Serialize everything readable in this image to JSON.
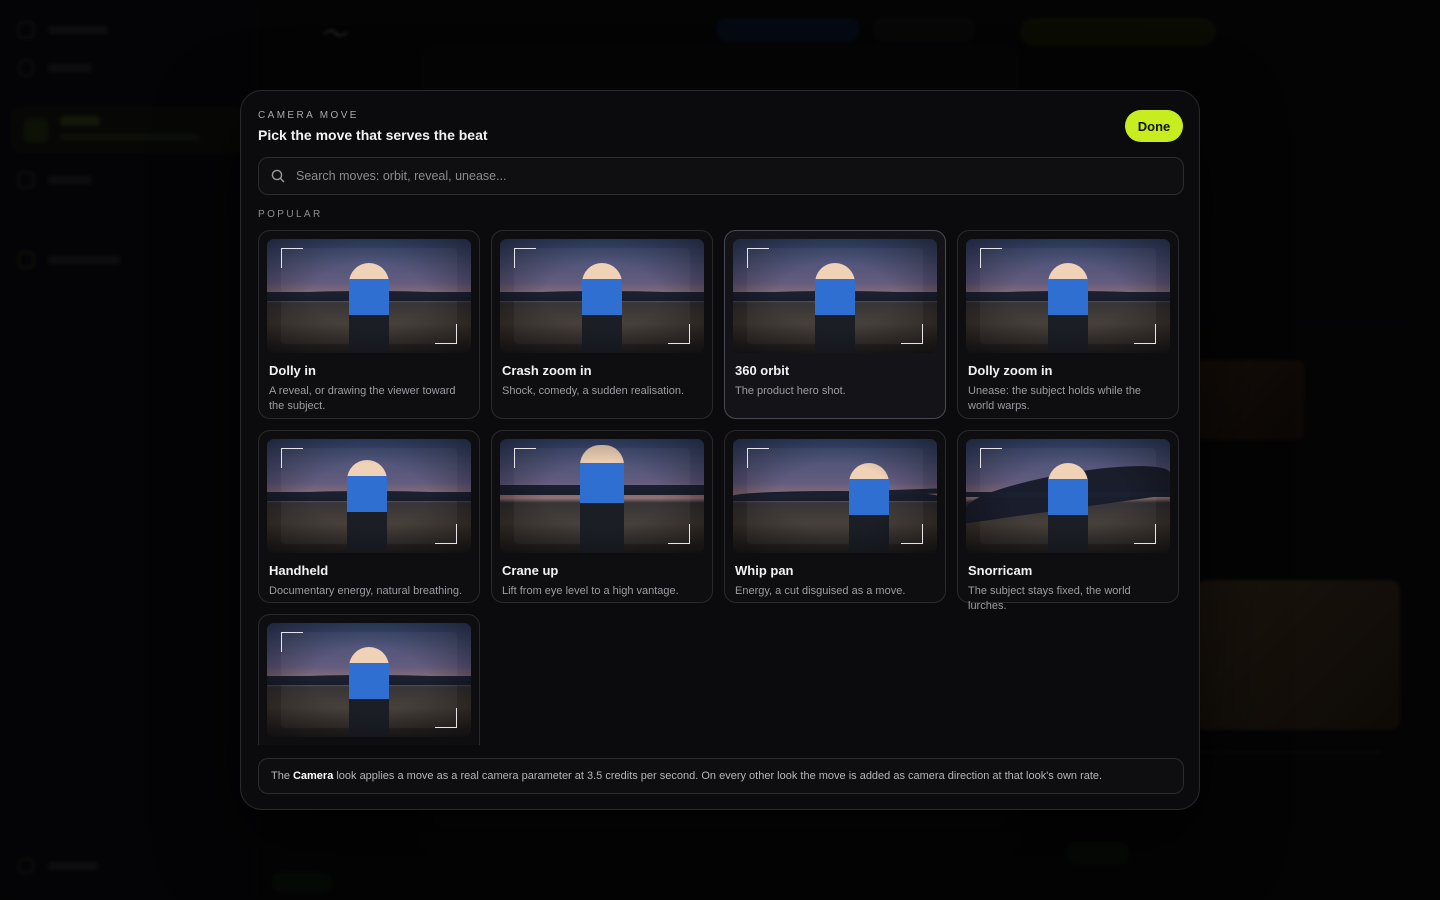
{
  "modal": {
    "eyebrow": "CAMERA MOVE",
    "title": "Pick the move that serves the beat",
    "done_label": "Done",
    "search_placeholder": "Search moves: orbit, reveal, unease...",
    "section_label": "POPULAR",
    "footer": {
      "prefix": "The",
      "highlight": "Camera",
      "suffix": "look applies a move as a real camera parameter at 3.5 credits per second. On every other look the move is added as camera direction at that look's own rate."
    }
  },
  "moves": [
    {
      "title": "Dolly in",
      "desc": "A reveal, or drawing the viewer toward the subject."
    },
    {
      "title": "Crash zoom in",
      "desc": "Shock, comedy, a sudden realisation."
    },
    {
      "title": "360 orbit",
      "desc": "The product hero shot."
    },
    {
      "title": "Dolly zoom in",
      "desc": "Unease: the subject holds while the world warps."
    },
    {
      "title": "Handheld",
      "desc": "Documentary energy, natural breathing."
    },
    {
      "title": "Crane up",
      "desc": "Lift from eye level to a high vantage."
    },
    {
      "title": "Whip pan",
      "desc": "Energy, a cut disguised as a move."
    },
    {
      "title": "Snorricam",
      "desc": "The subject stays fixed, the world lurches."
    }
  ],
  "selected_index": 2,
  "accent_color": "#c7ec1f"
}
